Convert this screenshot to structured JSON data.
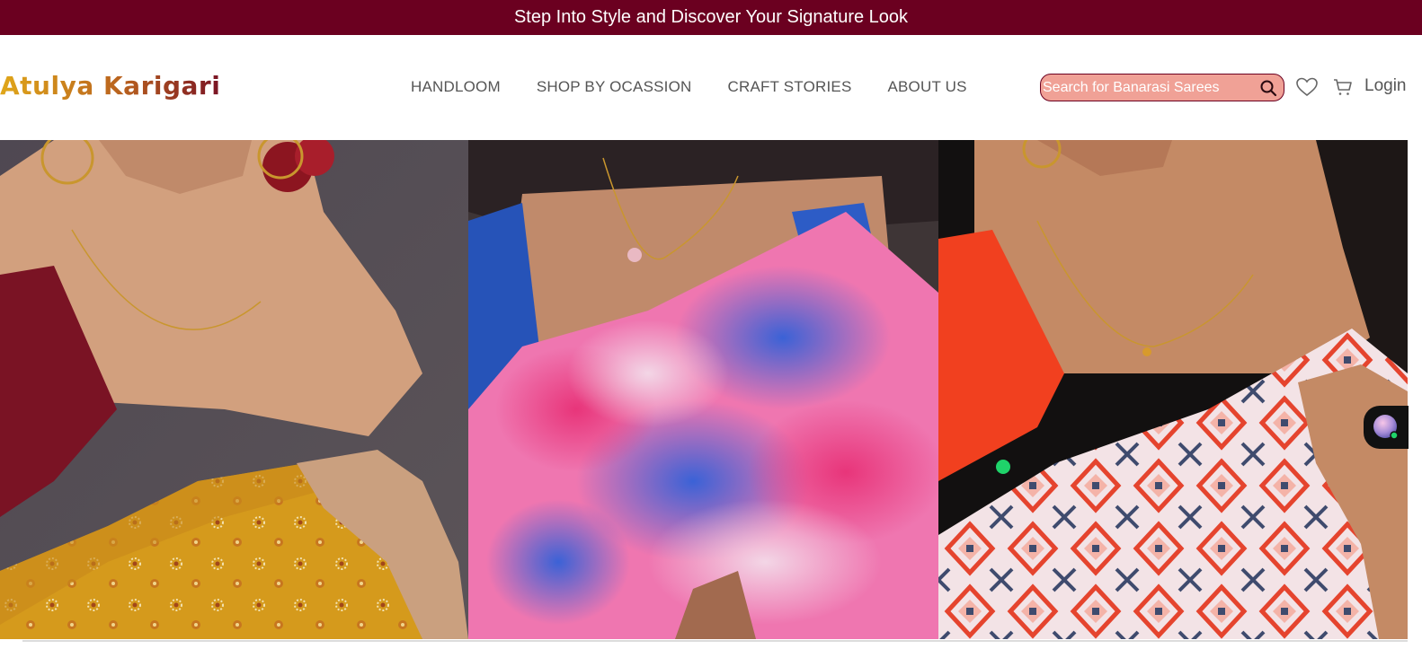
{
  "announcement": {
    "text": "Step Into Style and Discover Your Signature Look"
  },
  "header": {
    "logo": "Atulya Karigari",
    "nav": [
      {
        "label": "HANDLOOM"
      },
      {
        "label": "SHOP BY OCASSION"
      },
      {
        "label": "CRAFT STORIES"
      },
      {
        "label": "ABOUT US"
      }
    ],
    "search": {
      "placeholder": "Search for Banarasi Sarees"
    },
    "icons": {
      "search": "search-icon",
      "wishlist": "heart-icon",
      "cart": "cart-icon"
    },
    "login_label": "Login"
  },
  "hero": {
    "slides": [
      {
        "description_icon": "saree-yellow-bandhani-image"
      },
      {
        "description_icon": "saree-pink-blue-tie-dye-image"
      },
      {
        "description_icon": "saree-ikat-print-image"
      }
    ]
  },
  "colors": {
    "brand": "#6b0020",
    "search_bg": "#f0a196",
    "nav_text": "#555555",
    "chat_status": "#1fd36a"
  }
}
